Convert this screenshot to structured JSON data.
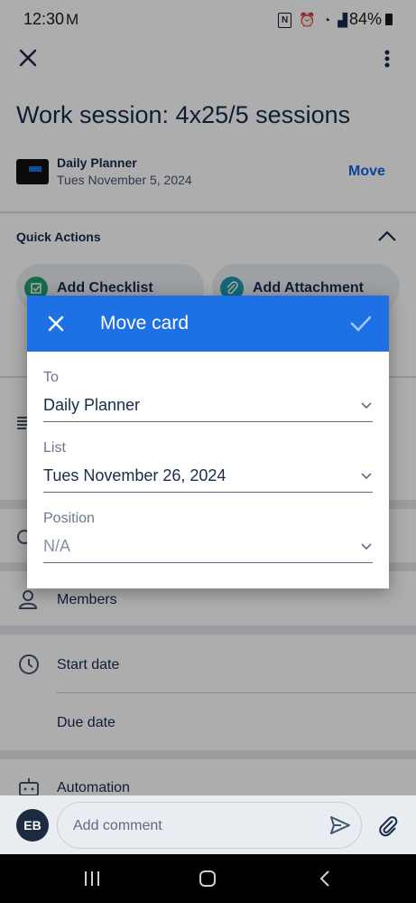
{
  "status_bar": {
    "time": "12:30",
    "battery": "84%"
  },
  "card": {
    "title": "Work session: 4x25/5 sessions",
    "board_name": "Daily Planner",
    "list_name": "Tues November 5, 2024",
    "move_label": "Move"
  },
  "quick_actions": {
    "label": "Quick Actions",
    "items": [
      "Add Checklist",
      "Add Attachment"
    ]
  },
  "sections": {
    "members": "Members",
    "start_date": "Start date",
    "due_date": "Due date",
    "automation": "Automation"
  },
  "comment": {
    "avatar_initials": "EB",
    "placeholder": "Add comment"
  },
  "dialog": {
    "title": "Move card",
    "fields": [
      {
        "label": "To",
        "value": "Daily Planner",
        "disabled": false
      },
      {
        "label": "List",
        "value": "Tues November 26, 2024",
        "disabled": false
      },
      {
        "label": "Position",
        "value": "N/A",
        "disabled": true
      }
    ]
  },
  "colors": {
    "dialog_header": "#1d71e5",
    "checklist_icon": "#22a06b",
    "attachment_icon": "#1d9aaa",
    "move_link": "#0c66e4"
  }
}
